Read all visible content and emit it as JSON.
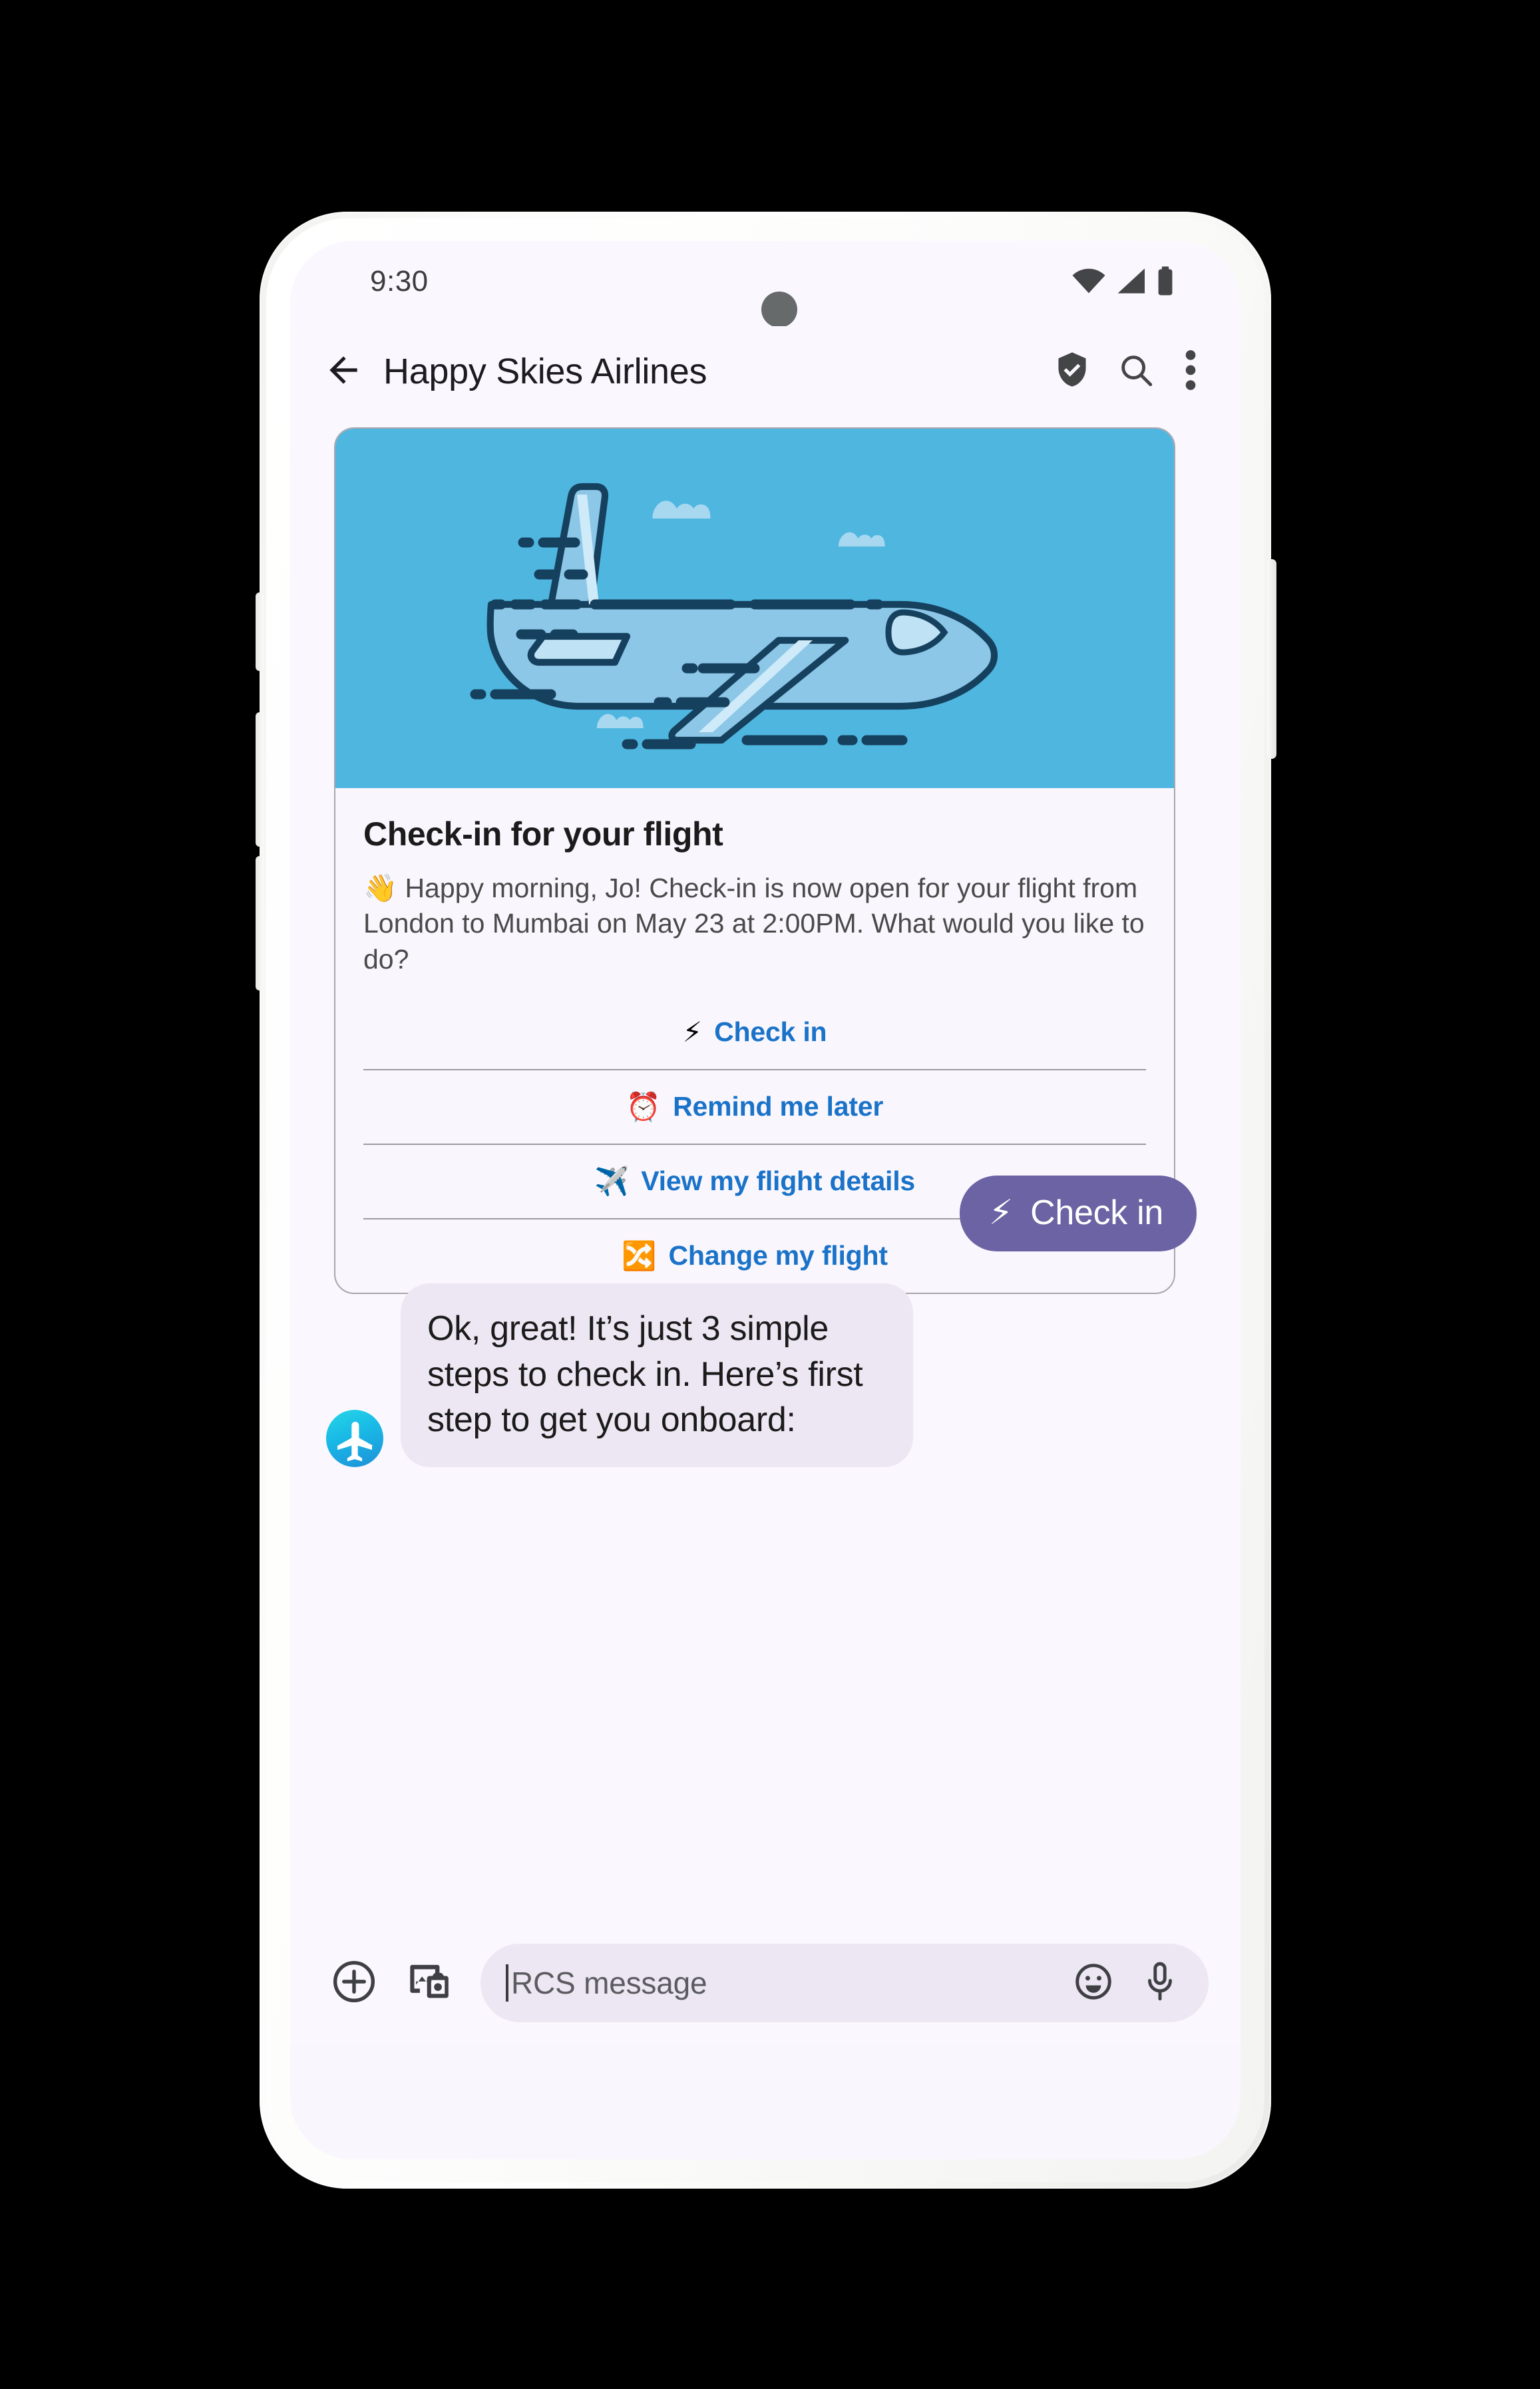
{
  "status_bar": {
    "time": "9:30",
    "icons": [
      "wifi-icon",
      "cellular-signal-icon",
      "battery-icon"
    ]
  },
  "app_bar": {
    "back_icon": "back-arrow-icon",
    "title": "Happy Skies Airlines",
    "verified_icon": "verified-shield-icon",
    "search_icon": "search-icon",
    "more_icon": "more-vertical-icon"
  },
  "rich_card": {
    "hero_alt": "airplane-illustration",
    "hero_bg": "#4fb6e0",
    "title": "Check-in for your flight",
    "description": "👋 Happy morning, Jo! Check-in is now open for your flight from London to Mumbai on May 23 at 2:00PM. What would you like to do?",
    "link_color": "#1a73c8",
    "actions": [
      {
        "emoji": "⚡",
        "label": "Check in"
      },
      {
        "emoji": "⏰",
        "label": "Remind me later"
      },
      {
        "emoji": "✈️",
        "label": "View my flight details"
      },
      {
        "emoji": "🔀",
        "label": "Change my flight"
      }
    ]
  },
  "messages": [
    {
      "direction": "outgoing",
      "emoji": "⚡",
      "text": "Check in",
      "bubble_color": "#6b63a3",
      "text_color": "#ffffff"
    },
    {
      "direction": "incoming",
      "avatar": "airline-avatar",
      "text": "Ok, great! It’s just 3 simple steps to check in. Here’s first step to get you onboard:",
      "bubble_color": "#ece7f3",
      "text_color": "#1b1b1b"
    }
  ],
  "composer": {
    "add_icon": "plus-circle-icon",
    "gallery_icon": "image-camera-icon",
    "placeholder": "RCS message",
    "emoji_icon": "emoji-smiley-icon",
    "mic_icon": "microphone-icon"
  },
  "theme": {
    "screen_bg": "#faf7fe",
    "card_bg": "#f9f6fd",
    "accent_purple": "#6b63a3",
    "accent_blue": "#1a73c8",
    "hero_blue": "#4fb6e0"
  }
}
